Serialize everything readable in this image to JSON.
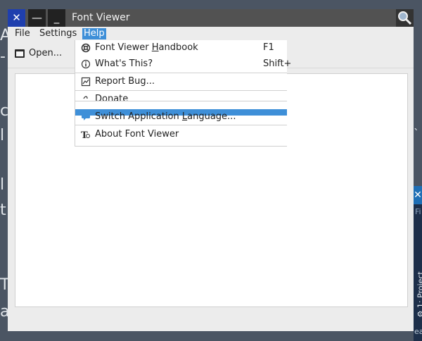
{
  "background_fragments": [
    "A",
    "-",
    "c",
    "l",
    "l",
    "t",
    "T",
    "a",
    "`"
  ],
  "side_window": {
    "close": "✕",
    "file": "Fi",
    "vertical": "⚙ 1: Project",
    "learn": "earn"
  },
  "window": {
    "title": "Font Viewer",
    "buttons": {
      "close": "✕",
      "min1": "—",
      "min2": "_"
    }
  },
  "menubar": {
    "file": "File",
    "settings": "Settings",
    "help": "Help"
  },
  "toolbar": {
    "open": "Open..."
  },
  "help_menu": {
    "handbook": {
      "pre": "Font Viewer ",
      "mn": "H",
      "post": "andbook",
      "shortcut": "F1"
    },
    "whats_this": {
      "label": "What's This?",
      "shortcut": "Shift+"
    },
    "report_bug": {
      "label": "Report Bug..."
    },
    "donate": {
      "label": "Donate"
    },
    "switch_lang": {
      "pre": "Switch Application ",
      "mn": "L",
      "post": "anguage..."
    },
    "about": {
      "label": "About Font Viewer"
    }
  },
  "colors": {
    "accent": "#3e8fd8",
    "close_button": "#1f3fae",
    "desktop": "#4b5563"
  }
}
